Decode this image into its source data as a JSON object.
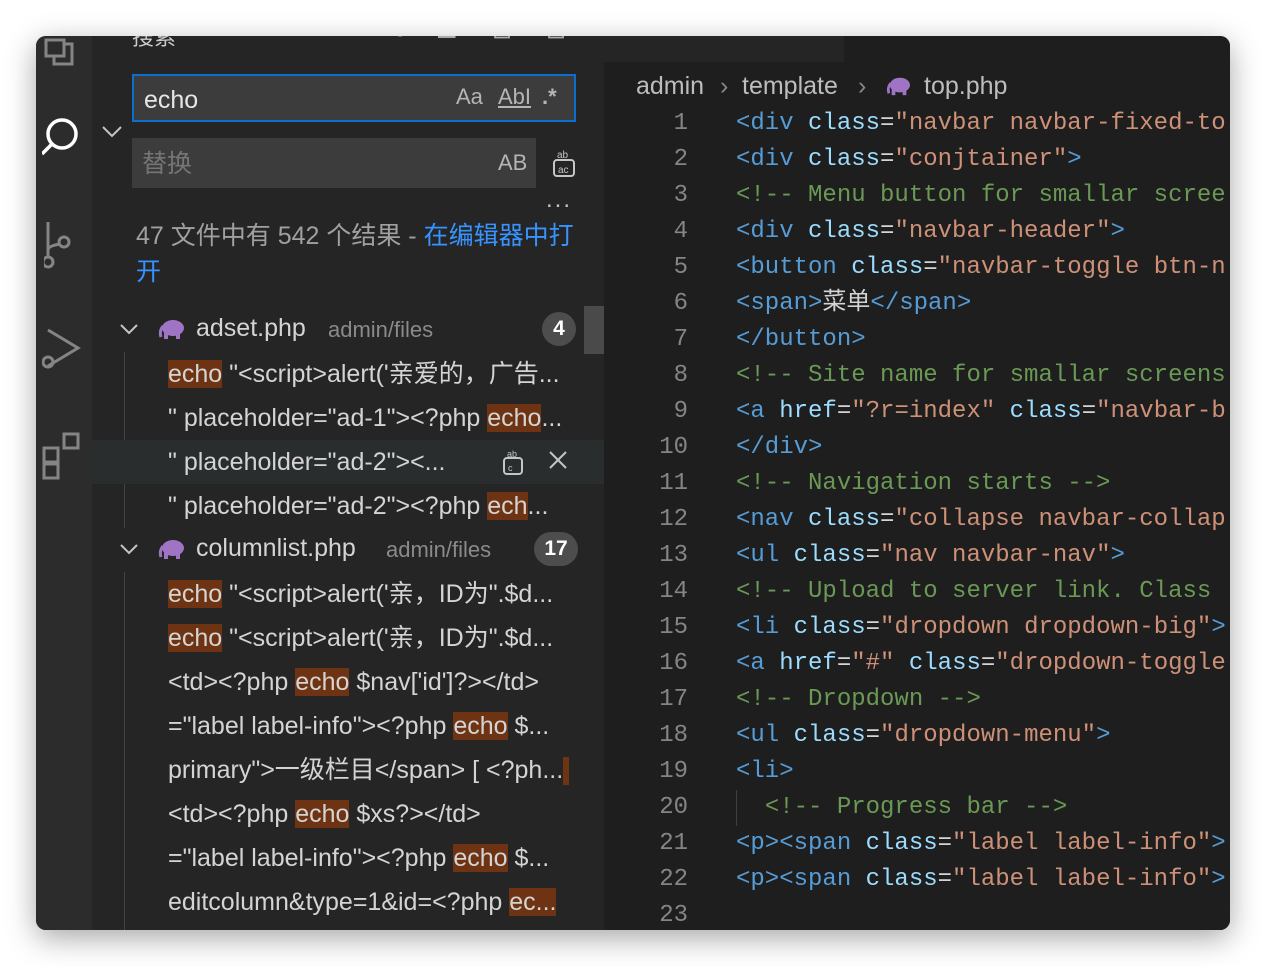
{
  "sidebar": {
    "title": "搜索",
    "search": {
      "value": "echo",
      "opts": [
        "Aa",
        "AbI",
        ".*"
      ]
    },
    "replace": {
      "placeholder": "替换",
      "opt": "AB",
      "more": "..."
    },
    "summary": {
      "text": "47 文件中有 542 个结果 - ",
      "link": "在编辑器中打开"
    },
    "files": [
      {
        "name": "adset.php",
        "path": "admin/files",
        "count": "4",
        "matches": [
          {
            "pre": "",
            "hl": "echo",
            "post": " \"<script>alert('亲爱的，广告..."
          },
          {
            "pre": "\" placeholder=\"ad-1\"><?php ",
            "hl": "echo",
            "post": "..."
          },
          {
            "pre": "\" placeholder=\"ad-2\"><...",
            "hl": "",
            "post": ""
          },
          {
            "pre": "\" placeholder=\"ad-2\"><?php ",
            "hl": "ech",
            "post": "..."
          }
        ]
      },
      {
        "name": "columnlist.php",
        "path": "admin/files",
        "count": "17",
        "matches": [
          {
            "pre": "",
            "hl": "echo",
            "post": " \"<script>alert('亲，ID为\".$d..."
          },
          {
            "pre": "",
            "hl": "echo",
            "post": " \"<script>alert('亲，ID为\".$d..."
          },
          {
            "pre": "<td><?php ",
            "hl": "echo",
            "post": " $nav['id']?></td>"
          },
          {
            "pre": "=\"label label-info\"><?php ",
            "hl": "echo",
            "post": "  $..."
          },
          {
            "pre": "primary\">一级栏目</span> [ <?ph...",
            "hl": "",
            "post": ""
          },
          {
            "pre": "<td><?php ",
            "hl": "echo",
            "post": "  $xs?></td>"
          },
          {
            "pre": "=\"label label-info\"><?php ",
            "hl": "echo",
            "post": "  $..."
          },
          {
            "pre": "editcolumn&type=1&id=<?php ",
            "hl": "ec...",
            "post": ""
          }
        ]
      }
    ]
  },
  "editor": {
    "breadcrumb": [
      "admin",
      "template",
      "top.php"
    ],
    "lines": [
      {
        "n": "1",
        "t": [
          [
            "tag",
            "<div"
          ],
          [
            "txt",
            " "
          ],
          [
            "attr",
            "class"
          ],
          [
            "txt",
            "="
          ],
          [
            "str",
            "\"navbar navbar-fixed-to"
          ]
        ]
      },
      {
        "n": "2",
        "t": [
          [
            "tag",
            "<div"
          ],
          [
            "txt",
            " "
          ],
          [
            "attr",
            "class"
          ],
          [
            "txt",
            "="
          ],
          [
            "str",
            "\"conjtainer\""
          ],
          [
            "tag",
            ">"
          ]
        ]
      },
      {
        "n": "3",
        "t": [
          [
            "cmt",
            "<!-- Menu button for smallar scree"
          ]
        ]
      },
      {
        "n": "4",
        "t": [
          [
            "tag",
            "<div"
          ],
          [
            "txt",
            " "
          ],
          [
            "attr",
            "class"
          ],
          [
            "txt",
            "="
          ],
          [
            "str",
            "\"navbar-header\""
          ],
          [
            "tag",
            ">"
          ]
        ]
      },
      {
        "n": "5",
        "t": [
          [
            "tag",
            "<button"
          ],
          [
            "txt",
            " "
          ],
          [
            "attr",
            "class"
          ],
          [
            "txt",
            "="
          ],
          [
            "str",
            "\"navbar-toggle btn-n"
          ]
        ]
      },
      {
        "n": "6",
        "t": [
          [
            "tag",
            "<span"
          ],
          [
            "tag",
            ">"
          ],
          [
            "txt",
            "菜单"
          ],
          [
            "tag",
            "</span>"
          ]
        ]
      },
      {
        "n": "7",
        "t": [
          [
            "tag",
            "</button>"
          ]
        ]
      },
      {
        "n": "8",
        "t": [
          [
            "cmt",
            "<!-- Site name for smallar screens"
          ]
        ]
      },
      {
        "n": "9",
        "t": [
          [
            "tag",
            "<a"
          ],
          [
            "txt",
            " "
          ],
          [
            "attr",
            "href"
          ],
          [
            "txt",
            "="
          ],
          [
            "str",
            "\"?r=index\""
          ],
          [
            "txt",
            " "
          ],
          [
            "attr",
            "class"
          ],
          [
            "txt",
            "="
          ],
          [
            "str",
            "\"navbar-b"
          ]
        ]
      },
      {
        "n": "10",
        "t": [
          [
            "tag",
            "</div>"
          ]
        ]
      },
      {
        "n": "11",
        "t": [
          [
            "cmt",
            "<!-- Navigation starts -->"
          ]
        ]
      },
      {
        "n": "12",
        "t": [
          [
            "tag",
            "<nav"
          ],
          [
            "txt",
            " "
          ],
          [
            "attr",
            "class"
          ],
          [
            "txt",
            "="
          ],
          [
            "str",
            "\"collapse navbar-collap"
          ]
        ]
      },
      {
        "n": "13",
        "t": [
          [
            "tag",
            "<ul"
          ],
          [
            "txt",
            " "
          ],
          [
            "attr",
            "class"
          ],
          [
            "txt",
            "="
          ],
          [
            "str",
            "\"nav navbar-nav\""
          ],
          [
            "tag",
            ">"
          ]
        ]
      },
      {
        "n": "14",
        "t": [
          [
            "cmt",
            "<!-- Upload to server link. Class '"
          ]
        ]
      },
      {
        "n": "15",
        "t": [
          [
            "tag",
            "<li"
          ],
          [
            "txt",
            " "
          ],
          [
            "attr",
            "class"
          ],
          [
            "txt",
            "="
          ],
          [
            "str",
            "\"dropdown dropdown-big\""
          ],
          [
            "tag",
            ">"
          ]
        ]
      },
      {
        "n": "16",
        "t": [
          [
            "tag",
            "<a"
          ],
          [
            "txt",
            " "
          ],
          [
            "attr",
            "href"
          ],
          [
            "txt",
            "="
          ],
          [
            "str",
            "\"#\""
          ],
          [
            "txt",
            " "
          ],
          [
            "attr",
            "class"
          ],
          [
            "txt",
            "="
          ],
          [
            "str",
            "\"dropdown-toggle"
          ]
        ]
      },
      {
        "n": "17",
        "t": [
          [
            "cmt",
            "<!-- Dropdown -->"
          ]
        ]
      },
      {
        "n": "18",
        "t": [
          [
            "tag",
            "<ul"
          ],
          [
            "txt",
            " "
          ],
          [
            "attr",
            "class"
          ],
          [
            "txt",
            "="
          ],
          [
            "str",
            "\"dropdown-menu\""
          ],
          [
            "tag",
            ">"
          ]
        ]
      },
      {
        "n": "19",
        "t": [
          [
            "tag",
            "<li>"
          ]
        ]
      },
      {
        "n": "20",
        "t": [
          [
            "txt",
            "  "
          ],
          [
            "cmt",
            "<!-- Progress bar -->"
          ]
        ]
      },
      {
        "n": "21",
        "t": [
          [
            "tag",
            "<p><span"
          ],
          [
            "txt",
            " "
          ],
          [
            "attr",
            "class"
          ],
          [
            "txt",
            "="
          ],
          [
            "str",
            "\"label label-info\""
          ],
          [
            "tag",
            ">"
          ]
        ]
      },
      {
        "n": "22",
        "t": [
          [
            "tag",
            "<p><span"
          ],
          [
            "txt",
            " "
          ],
          [
            "attr",
            "class"
          ],
          [
            "txt",
            "="
          ],
          [
            "str",
            "\"label label-info\""
          ],
          [
            "tag",
            ">"
          ]
        ]
      },
      {
        "n": "23",
        "t": []
      }
    ]
  }
}
